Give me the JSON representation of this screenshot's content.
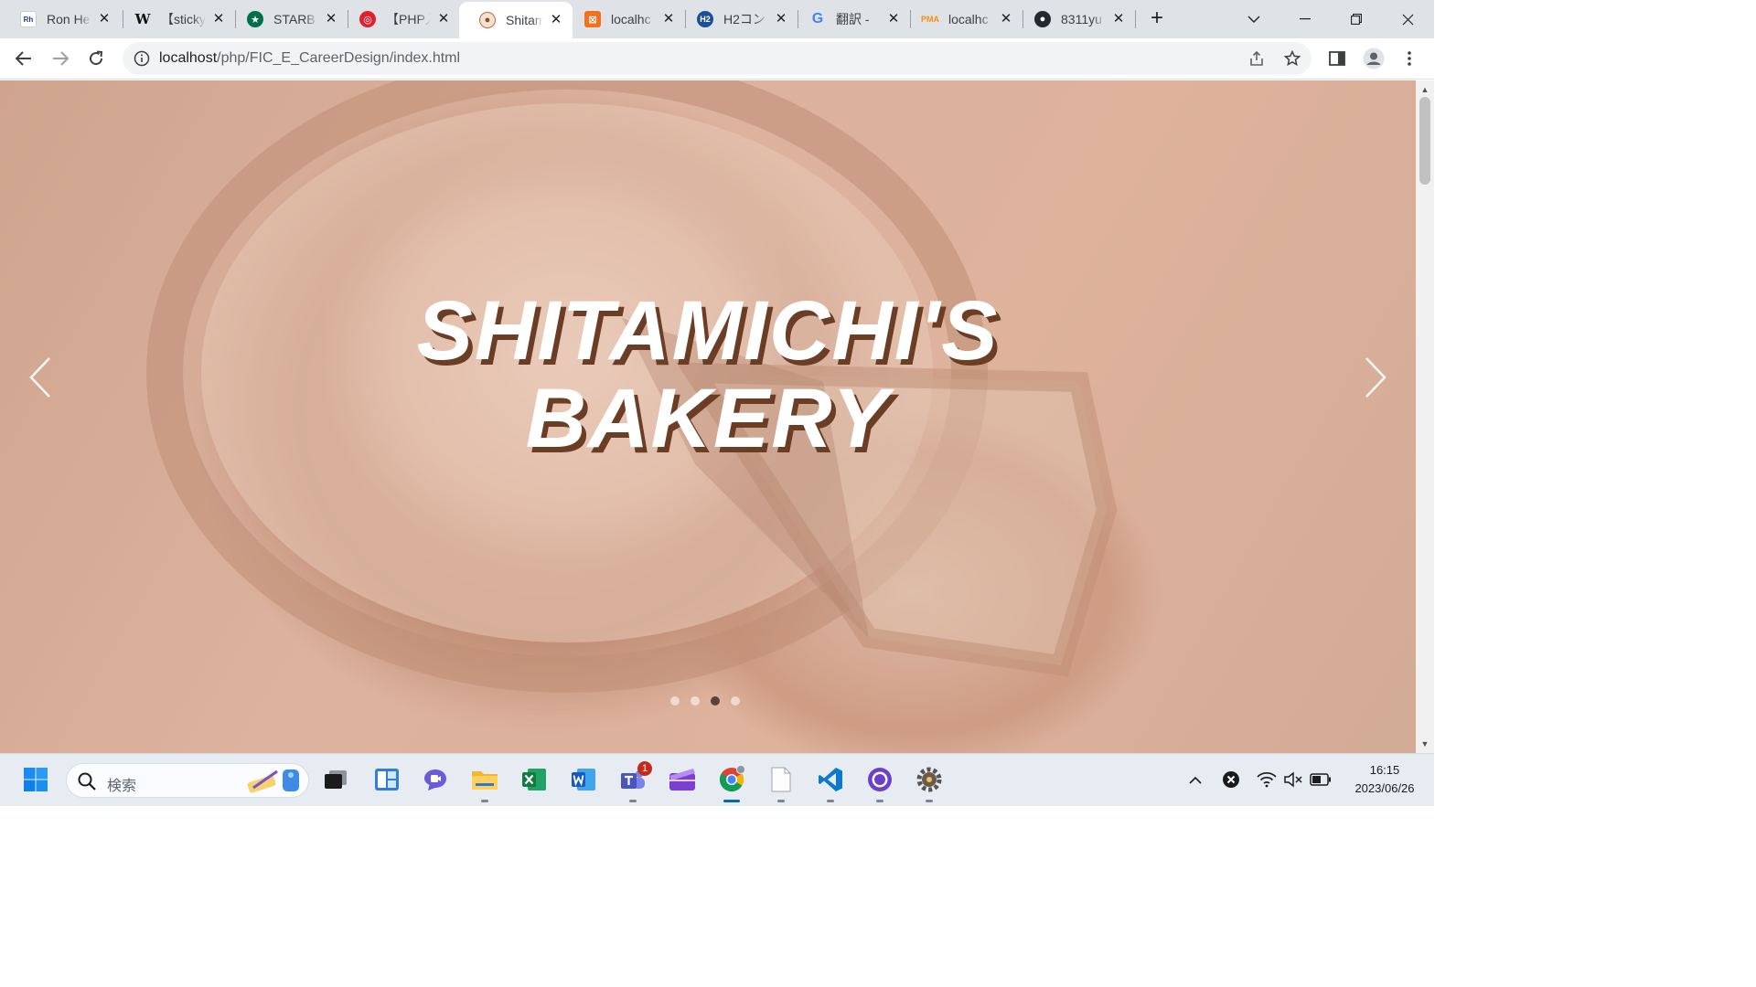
{
  "browser": {
    "tabs": [
      {
        "title": "Ron He",
        "favicon": "ron-favicon",
        "color": "#ffffff"
      },
      {
        "title": "【sticky",
        "favicon": "w-favicon",
        "color": "#ffffff"
      },
      {
        "title": "STARB",
        "favicon": "starbucks-favicon",
        "color": "#00704a"
      },
      {
        "title": "【PHP入",
        "favicon": "red-swirl-favicon",
        "color": "#e02030"
      },
      {
        "title": "Shitam",
        "favicon": "bakery-favicon",
        "color": "#a0522d"
      },
      {
        "title": "localhc",
        "favicon": "xampp-favicon",
        "color": "#f2711c"
      },
      {
        "title": "H2コン",
        "favicon": "h2-favicon",
        "color": "#1a4f9c"
      },
      {
        "title": "翻訳 -",
        "favicon": "google-favicon",
        "color": "#4285f4"
      },
      {
        "title": "localhc",
        "favicon": "phpmyadmin-favicon",
        "color": "#f29111"
      },
      {
        "title": "8311yu",
        "favicon": "github-favicon",
        "color": "#24292f"
      }
    ],
    "active_tab": 4,
    "url_host": "localhost",
    "url_path": "/php/FIC_E_CareerDesign/index.html"
  },
  "page": {
    "title_line1": "SHITAMICHI'S",
    "title_line2": "BAKERY",
    "slides": 4,
    "active_slide": 3
  },
  "taskbar": {
    "search_placeholder": "検索",
    "teams_badge": "1",
    "time": "16:15",
    "date": "2023/06/26"
  },
  "colors": {
    "accent": "#0067c0",
    "title_shadow": "#6b3d25",
    "active_dot": "#5a4238"
  }
}
